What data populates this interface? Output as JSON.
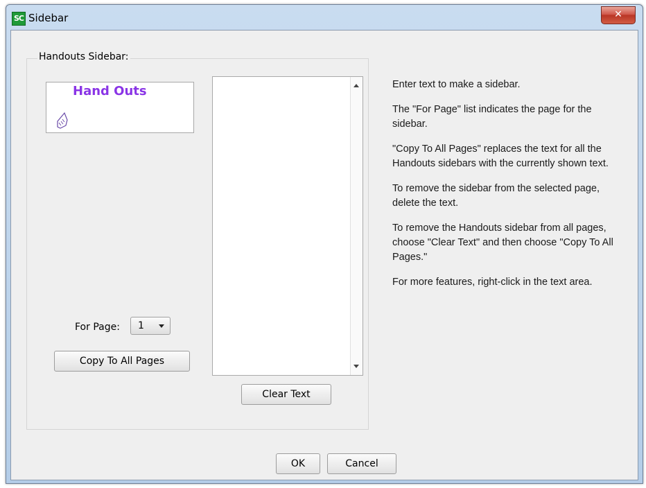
{
  "window": {
    "app_icon_text": "SC",
    "title": "Sidebar",
    "close_glyph": "✕"
  },
  "group": {
    "label": "Handouts Sidebar:",
    "preview_title": "Hand Outs",
    "preview_icon": "pointer-hand-icon"
  },
  "editor": {
    "text": ""
  },
  "page_selector": {
    "label": "For Page:",
    "value": "1"
  },
  "buttons": {
    "copy_all": "Copy To All Pages",
    "clear_text": "Clear Text",
    "ok": "OK",
    "cancel": "Cancel"
  },
  "help": {
    "p1": "Enter text to make a sidebar.",
    "p2": "The \"For Page\" list indicates the page for the sidebar.",
    "p3": "\"Copy To All Pages\" replaces the text for all the Handouts sidebars with the currently shown text.",
    "p4": "To remove the sidebar from the selected page, delete the text.",
    "p5": "To remove the Handouts sidebar from all pages, choose \"Clear Text\" and then choose \"Copy To All Pages.\"",
    "p6": "For more features, right-click in the text area."
  },
  "colors": {
    "preview_title": "#8a35e6",
    "app_icon": "#1f9a39",
    "close_button": "#c74a3a"
  }
}
